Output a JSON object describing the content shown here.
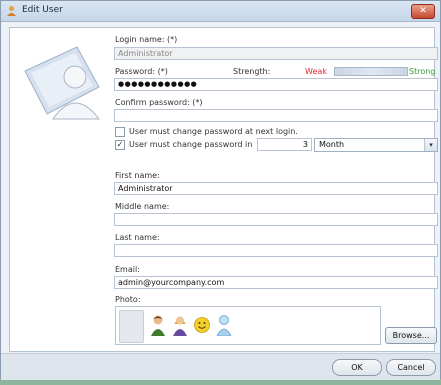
{
  "window": {
    "title": "Edit User",
    "close_glyph": "✕"
  },
  "fields": {
    "login_name_label": "Login name: (*)",
    "login_name_value": "Administrator",
    "password_label": "Password: (*)",
    "password_value": "●●●●●●●●●●●●",
    "strength_label": "Strength:",
    "strength_weak": "Weak",
    "strength_strong": "Strong",
    "confirm_label": "Confirm password: (*)",
    "confirm_value": "",
    "must_change_next_login_label": "User must change password at next login.",
    "must_change_next_login_checked": false,
    "must_change_in_label": "User must change password in",
    "must_change_in_checked": true,
    "must_change_in_value": "3",
    "period_selected": "Month",
    "first_name_label": "First name:",
    "first_name_value": "Administrator",
    "middle_name_label": "Middle name:",
    "middle_name_value": "",
    "last_name_label": "Last name:",
    "last_name_value": "",
    "email_label": "Email:",
    "email_value": "admin@yourcompany.com",
    "photo_label": "Photo:"
  },
  "buttons": {
    "browse": "Browse...",
    "ok": "OK",
    "cancel": "Cancel"
  },
  "icons": {
    "title": "user-edit-icon",
    "big_avatar": "user-avatar-icon",
    "photos": [
      "man-avatar-icon",
      "woman-avatar-icon",
      "smiley-avatar-icon",
      "generic-user-avatar-icon"
    ]
  },
  "colors": {
    "weak": "#e03030",
    "strong": "#3a9a3a",
    "title_bar": "#c5d6ea"
  }
}
